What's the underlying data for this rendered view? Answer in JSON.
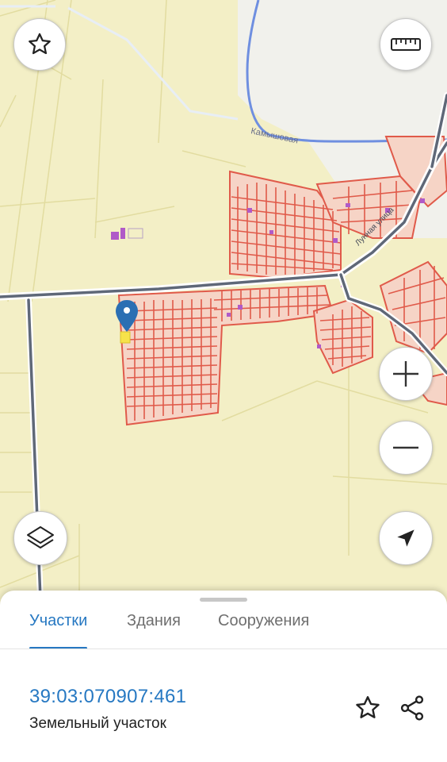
{
  "map": {
    "street_label_1": "Камышовая",
    "street_label_2": "Лунная улица",
    "marker_type": "location-pin",
    "colors": {
      "background": "#f3efc6",
      "parcel_outline": "#e05a4a",
      "parcel_fill": "#f2c8b8",
      "road": "#5f6878",
      "river": "#6f8fe0",
      "pin": "#2b6fb3"
    }
  },
  "controls": {
    "favorite_icon": "star-icon",
    "ruler_icon": "ruler-icon",
    "zoom_in_icon": "plus-icon",
    "zoom_out_icon": "minus-icon",
    "layers_icon": "layers-icon",
    "locate_icon": "navigation-arrow-icon"
  },
  "sheet": {
    "tabs": [
      {
        "label": "Участки",
        "active": true
      },
      {
        "label": "Здания",
        "active": false
      },
      {
        "label": "Сооружения",
        "active": false
      }
    ],
    "parcel": {
      "cadastral_number": "39:03:070907:461",
      "type": "Земельный участок"
    },
    "actions": {
      "favorite_icon": "star-outline-icon",
      "share_icon": "share-icon"
    }
  }
}
